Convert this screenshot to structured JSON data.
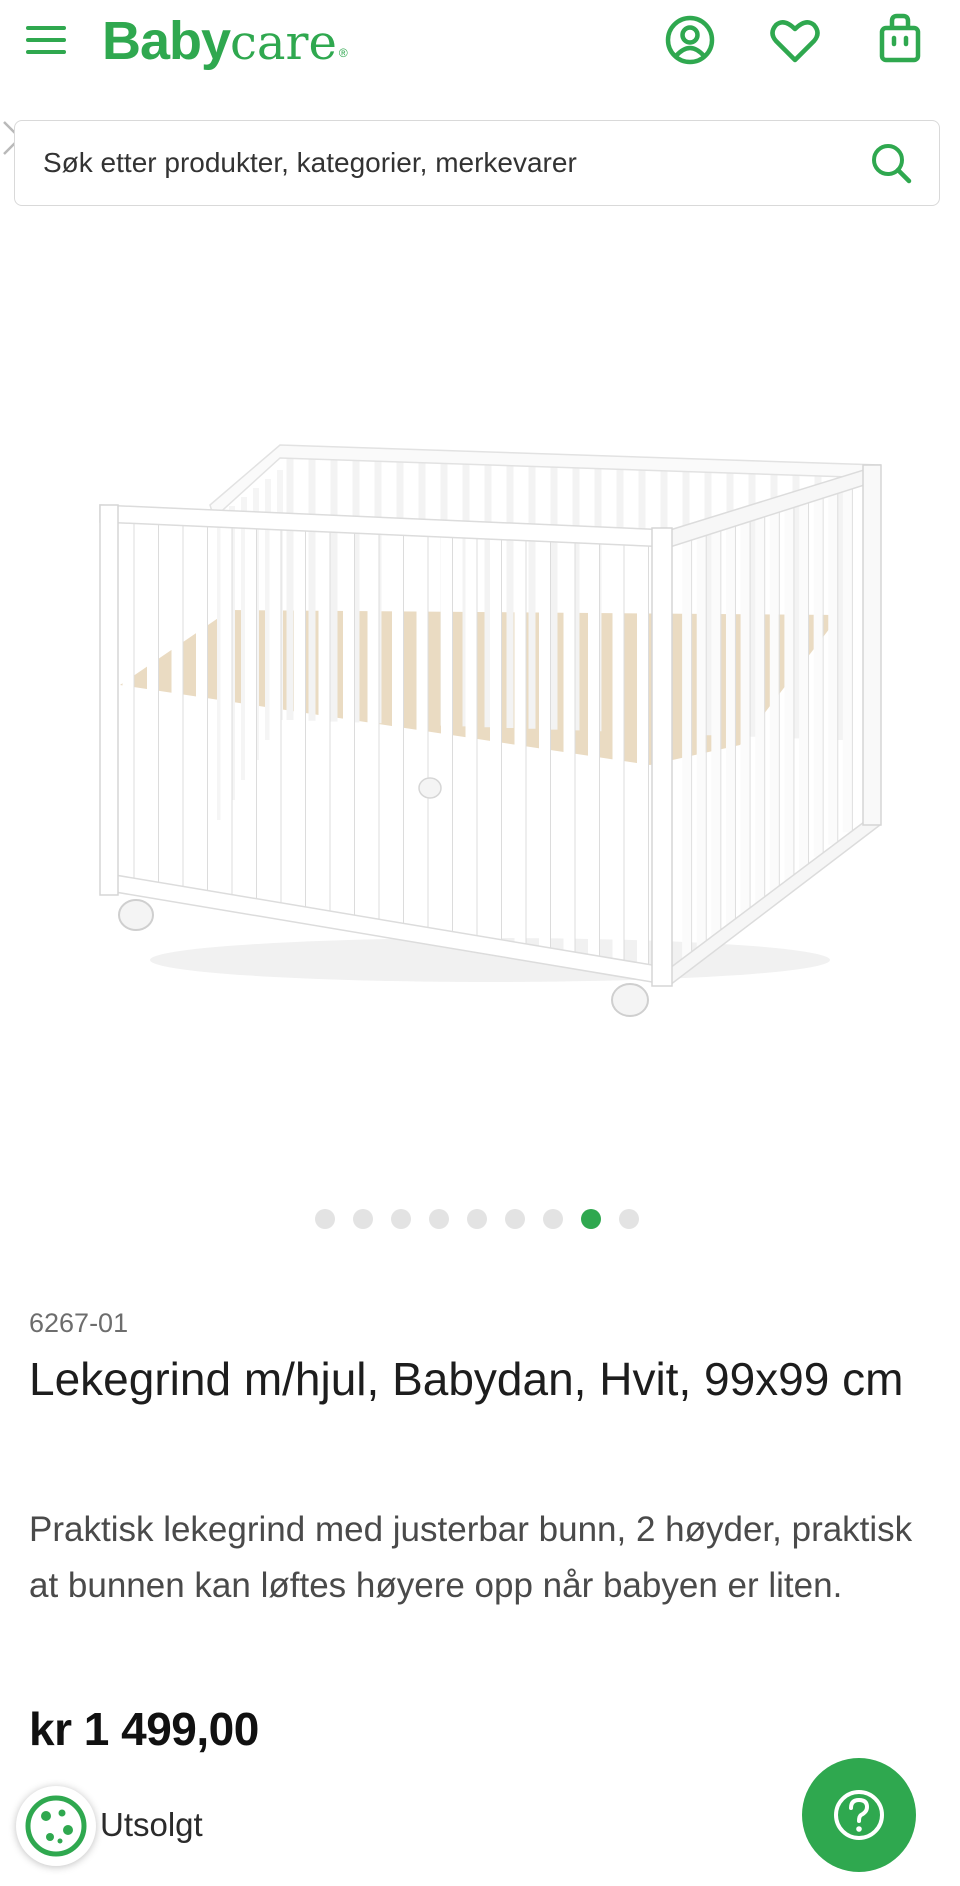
{
  "brand": {
    "name_bold": "Baby",
    "name_light": "care",
    "mark": "®"
  },
  "header": {
    "icons": [
      "menu-icon",
      "user-icon",
      "heart-icon",
      "shopping-bag-icon"
    ]
  },
  "search": {
    "placeholder": "Søk etter produkter, kategorier, merkevarer"
  },
  "carousel": {
    "count": 9,
    "active_index": 7
  },
  "product": {
    "sku": "6267-01",
    "title": "Lekegrind m/hjul, Babydan, Hvit, 99x99 cm",
    "description": "Praktisk lekegrind med justerbar bunn, 2 høyder, praktisk at bunnen kan løftes høyere opp når babyen er liten.",
    "price": "kr 1 499,00",
    "stock_status": "Utsolgt"
  },
  "colors": {
    "accent": "#2fa84f",
    "text": "#1d1d1d",
    "muted": "#6d6d6d"
  }
}
